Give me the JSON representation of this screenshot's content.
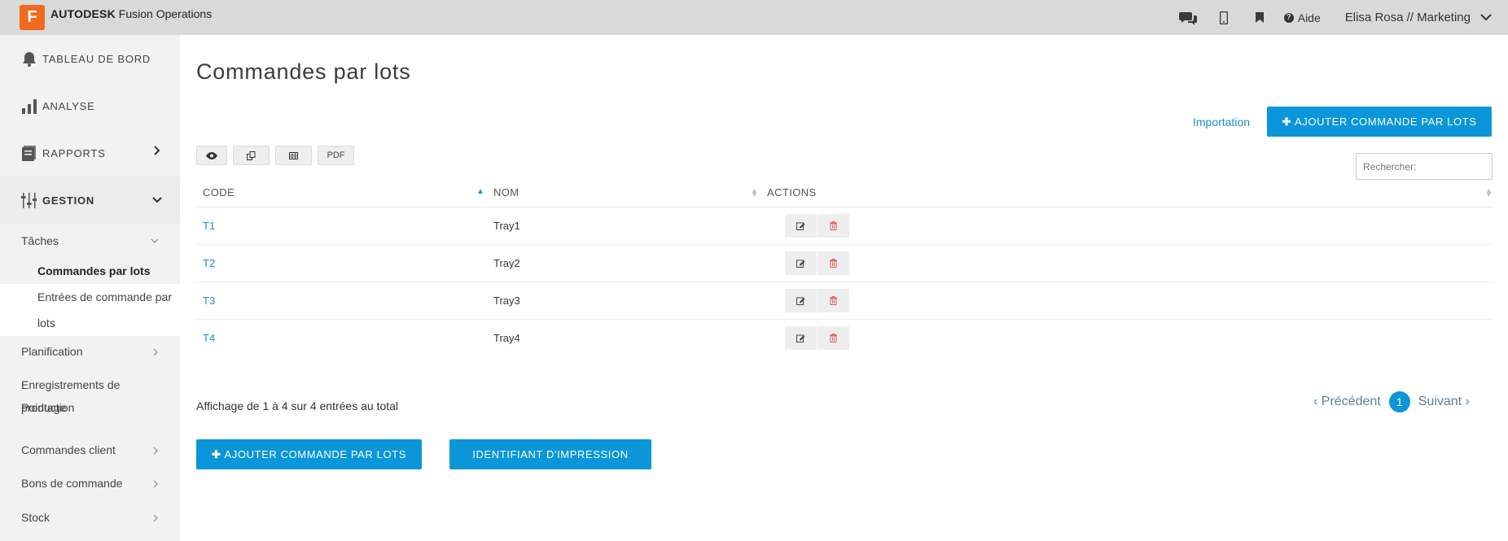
{
  "header": {
    "logo_letter": "F",
    "brand_bold": "AUTODESK",
    "brand_product": "Fusion Operations",
    "icons": [
      "chat-icon",
      "mobile-icon",
      "bookmark-icon"
    ],
    "help_label": "Aide",
    "user_label": "Elisa Rosa // Marketing"
  },
  "sidebar": {
    "main_items": [
      {
        "label": "TABLEAU DE BORD",
        "icon": "bell-icon"
      },
      {
        "label": "ANALYSE",
        "icon": "bar-chart-icon"
      },
      {
        "label": "RAPPORTS",
        "icon": "report-icon"
      },
      {
        "label": "GESTION",
        "icon": "sliders-icon"
      }
    ],
    "sub_taches": "Tâches",
    "leaf_active": "Commandes par lots",
    "leaf_entries_line1": "Entrées de commande par",
    "leaf_entries_line2": "lots",
    "planification": "Planification",
    "enregistrements_line1": "Enregistrements de",
    "enregistrements_line2a": "production",
    "enregistrements_line2b": "Pointage",
    "commandes_client": "Commandes client",
    "bons_de_commande": "Bons de commande",
    "stock": "Stock"
  },
  "main": {
    "title": "Commandes par lots",
    "import_link": "Importation",
    "add_button": "AJOUTER COMMANDE PAR LOTS",
    "search_placeholder": "Rechercher:",
    "tools": [
      "eye-icon",
      "copy-icon",
      "table-icon"
    ],
    "tool_pdf": "PDF",
    "columns": {
      "code": "CODE",
      "nom": "NOM",
      "actions": "ACTIONS"
    },
    "rows": [
      {
        "code": "T1",
        "nom": "Tray1"
      },
      {
        "code": "T2",
        "nom": "Tray2"
      },
      {
        "code": "T3",
        "nom": "Tray3"
      },
      {
        "code": "T4",
        "nom": "Tray4"
      }
    ],
    "info": "Affichage de 1 à 4 sur 4 entrées au total",
    "pager": {
      "prev": "Précédent",
      "current": "1",
      "next": "Suivant"
    },
    "print_button": "IDENTIFIANT D'IMPRESSION"
  },
  "colors": {
    "accent": "#0a96d8",
    "link": "#1b8fd2",
    "logo": "#f06a1d",
    "delete": "#e05a5a"
  }
}
